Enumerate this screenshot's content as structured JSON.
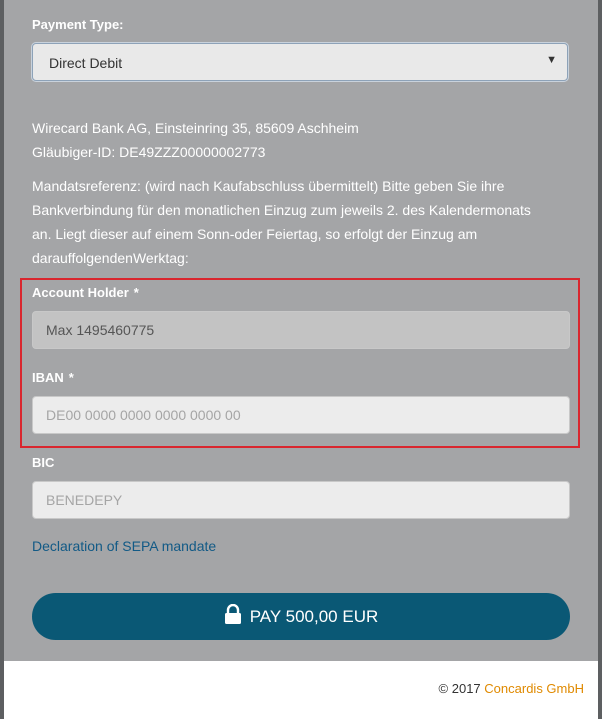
{
  "form": {
    "payment_type_label": "Payment Type:",
    "payment_type_value": "Direct Debit",
    "creditor_line1": "Wirecard Bank AG, Einsteinring 35, 85609 Aschheim",
    "creditor_line2": "Gläubiger-ID: DE49ZZZ00000002773",
    "mandate_text": "Mandatsreferenz: (wird nach Kaufabschluss übermittelt) Bitte geben Sie ihre Bankverbindung für den monatlichen Einzug zum jeweils 2. des Kalendermonats an. Liegt dieser auf einem Sonn-oder Feiertag, so erfolgt der Einzug am darauffolgendenWerktag:",
    "account_holder_label": "Account Holder",
    "account_holder_value": "Max 1495460775",
    "iban_label": "IBAN",
    "iban_placeholder": "DE00 0000 0000 0000 0000 00",
    "bic_label": "BIC",
    "bic_placeholder": "BENEDEPY",
    "required_marker": "*",
    "sepa_link": "Declaration of SEPA mandate",
    "pay_button": "PAY 500,00 EUR"
  },
  "footer": {
    "copyright": "© 2017",
    "brand": "Concardis GmbH"
  },
  "colors": {
    "panel_bg": "#a4a5a7",
    "pay_button_bg": "#0a5875",
    "link": "#125a86",
    "brand": "#e08a00",
    "highlight": "#d9262e"
  }
}
